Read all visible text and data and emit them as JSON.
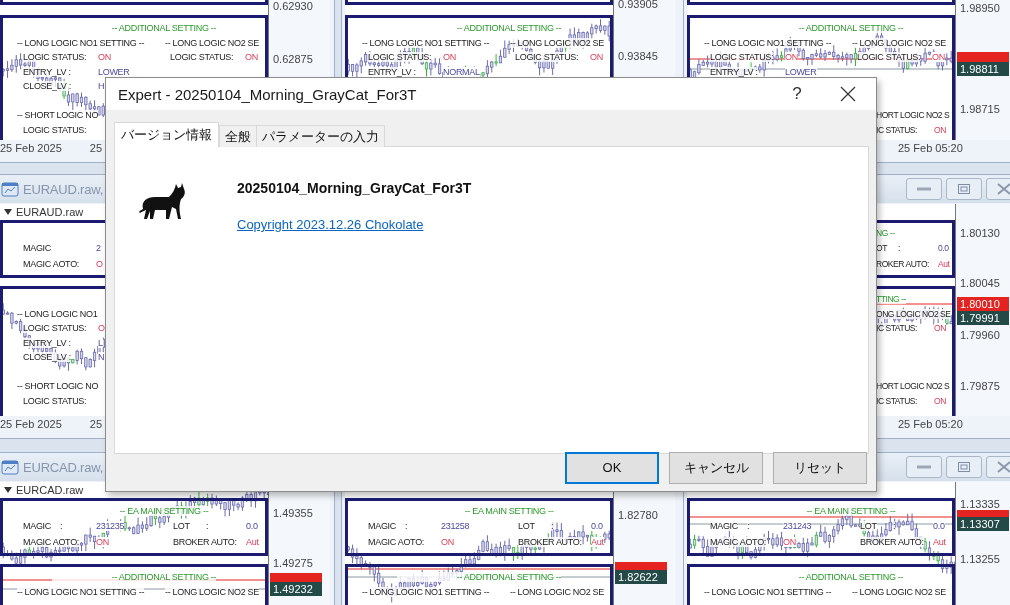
{
  "window_rows": [
    {
      "windows": [
        {
          "panels": [
            {
              "kind": "edge"
            },
            {
              "kind": "logic",
              "rows": [
                {
                  "kind": "heading",
                  "clipped": false,
                  "text": "-- ADDITIONAL SETTING --"
                },
                {
                  "kind": "titles",
                  "clipped": false,
                  "texts": [
                    "-- LONG LOGIC NO1 SETTING --",
                    "-- LONG LOGIC NO2 SE"
                  ]
                },
                {
                  "kind": "fields",
                  "clipped": false,
                  "fields": [
                    {
                      "label": "LOGIC STATUS:",
                      "value": "ON",
                      "alert": true
                    },
                    {
                      "label": "LOGIC STATUS:",
                      "value": "ON",
                      "alert": true
                    }
                  ]
                },
                {
                  "kind": "fields",
                  "clipped": false,
                  "fields": [
                    {
                      "label": "ENTRY_LV :",
                      "value": "LOWER",
                      "alert": false
                    }
                  ]
                },
                {
                  "kind": "fields",
                  "clipped": false,
                  "fields": [
                    {
                      "label": "CLOSE_LV :",
                      "value": "H",
                      "alert": false
                    }
                  ]
                },
                {
                  "kind": "gap"
                },
                {
                  "kind": "titles",
                  "clipped": false,
                  "texts": [
                    "-- SHORT LOGIC NO"
                  ]
                },
                {
                  "kind": "fields",
                  "clipped": false,
                  "fields": [
                    {
                      "label": "LOGIC STATUS:"
                    }
                  ]
                }
              ]
            }
          ],
          "prices": [
            {
              "kind": "tick",
              "text": "0.62930"
            },
            {
              "kind": "tick",
              "text": "0.62875"
            }
          ],
          "dates": [
            "25 Feb 2025",
            "25"
          ]
        },
        {
          "panels": [
            {
              "kind": "edge"
            },
            {
              "kind": "logic",
              "rows": [
                {
                  "kind": "heading",
                  "clipped": false,
                  "text": "-- ADDITIONAL SETTING --"
                },
                {
                  "kind": "titles",
                  "clipped": false,
                  "texts": [
                    "-- LONG LOGIC NO1 SETTING --",
                    "-- LONG LOGIC NO2 SE"
                  ]
                },
                {
                  "kind": "fields",
                  "clipped": false,
                  "fields": [
                    {
                      "label": "LOGIC STATUS:",
                      "value": "ON",
                      "alert": true
                    },
                    {
                      "label": "LOGIC STATUS:",
                      "value": "ON",
                      "alert": true
                    }
                  ]
                },
                {
                  "kind": "fields",
                  "clipped": false,
                  "fields": [
                    {
                      "label": "ENTRY_LV :",
                      "value": "NORMAL",
                      "alert": false
                    }
                  ]
                }
              ]
            }
          ],
          "prices": [
            {
              "kind": "tick",
              "text": "0.93905"
            },
            {
              "kind": "tick",
              "text": "0.93845"
            }
          ]
        },
        {
          "panels": [
            {
              "kind": "edge"
            },
            {
              "kind": "logic",
              "rows": [
                {
                  "kind": "heading",
                  "clipped": false,
                  "text": "-- ADDITIONAL SETTING --"
                },
                {
                  "kind": "titles",
                  "clipped": false,
                  "texts": [
                    "-- LONG LOGIC NO1 SETTING --",
                    "-- LONG LOGIC NO2 SE"
                  ]
                },
                {
                  "kind": "fields",
                  "clipped": false,
                  "fields": [
                    {
                      "label": "LOGIC STATUS:",
                      "value": "ON",
                      "alert": true
                    },
                    {
                      "label": "LOGIC STATUS:",
                      "value": "ON",
                      "alert": true
                    }
                  ]
                },
                {
                  "kind": "fields",
                  "clipped": false,
                  "fields": [
                    {
                      "label": "ENTRY_LV :",
                      "value": "LOWER",
                      "alert": false
                    }
                  ]
                },
                {
                  "kind": "gap"
                },
                {
                  "kind": "gap"
                },
                {
                  "kind": "titles",
                  "clipped": true,
                  "texts": [
                    "HORT LOGIC NO2 S"
                  ]
                },
                {
                  "kind": "fields",
                  "clipped": true,
                  "fields": [
                    {
                      "label": "IC STATUS:",
                      "value": "ON",
                      "alert": true
                    }
                  ]
                }
              ]
            }
          ],
          "prices": [
            {
              "kind": "tick",
              "text": "1.98950"
            },
            {
              "kind": "ask"
            },
            {
              "kind": "bid",
              "text": "1.98811"
            },
            {
              "kind": "tick",
              "text": "1.98715"
            }
          ],
          "dates": [
            "25 Feb 05:20"
          ]
        }
      ]
    },
    {
      "windows": [
        {
          "title": "EURAUD.raw,",
          "controls": false,
          "header": "EURAUD.raw",
          "panels": [
            {
              "kind": "main",
              "rows": [
                {
                  "kind": "gap"
                },
                {
                  "kind": "fields",
                  "clipped": false,
                  "fields": [
                    {
                      "label": "MAGIC",
                      "value": "2",
                      "alert": false
                    }
                  ]
                },
                {
                  "kind": "fields",
                  "clipped": false,
                  "fields": [
                    {
                      "label": "MAGIC AOTO:",
                      "value": "O",
                      "alert": true
                    }
                  ]
                }
              ]
            },
            {
              "kind": "logic",
              "rows": [
                {
                  "kind": "gap"
                },
                {
                  "kind": "titles",
                  "clipped": false,
                  "texts": [
                    "-- LONG LOGIC NO1"
                  ]
                },
                {
                  "kind": "fields",
                  "clipped": false,
                  "fields": [
                    {
                      "label": "LOGIC STATUS:",
                      "value": "O",
                      "alert": true
                    }
                  ]
                },
                {
                  "kind": "fields",
                  "clipped": false,
                  "fields": [
                    {
                      "label": "ENTRY_LV :",
                      "value": "L",
                      "alert": false
                    }
                  ]
                },
                {
                  "kind": "fields",
                  "clipped": false,
                  "fields": [
                    {
                      "label": "CLOSE_LV :",
                      "value": "N",
                      "alert": false
                    }
                  ]
                },
                {
                  "kind": "gap"
                },
                {
                  "kind": "titles",
                  "clipped": false,
                  "texts": [
                    "-- SHORT LOGIC NO"
                  ]
                },
                {
                  "kind": "fields",
                  "clipped": false,
                  "fields": [
                    {
                      "label": "LOGIC STATUS:"
                    }
                  ]
                }
              ]
            }
          ],
          "dates": [
            "25 Feb 2025",
            "25"
          ]
        },
        {
          "controls": true,
          "panels": [
            {
              "kind": "main",
              "rows": [
                {
                  "kind": "heading",
                  "clipped": true,
                  "text": "NG --"
                },
                {
                  "kind": "fields",
                  "clipped": true,
                  "fields": [
                    {
                      "label": "OT",
                      "sep": ":",
                      "value": "0.0",
                      "alert": false
                    }
                  ]
                },
                {
                  "kind": "fields",
                  "clipped": true,
                  "fields": [
                    {
                      "label": "ROKER AUTO:",
                      "value": "Aut",
                      "alert": true
                    }
                  ]
                }
              ]
            },
            {
              "kind": "logic",
              "rows": [
                {
                  "kind": "heading",
                  "clipped": true,
                  "text": "TTING --"
                },
                {
                  "kind": "titles",
                  "clipped": true,
                  "texts": [
                    "ONG LOGIC NO2 SE"
                  ]
                },
                {
                  "kind": "fields",
                  "clipped": true,
                  "fields": [
                    {
                      "label": "IC STATUS:",
                      "value": "ON",
                      "alert": true
                    }
                  ]
                },
                {
                  "kind": "gap"
                },
                {
                  "kind": "gap"
                },
                {
                  "kind": "gap"
                },
                {
                  "kind": "titles",
                  "clipped": true,
                  "texts": [
                    "HORT LOGIC NO2 S"
                  ]
                },
                {
                  "kind": "fields",
                  "clipped": true,
                  "fields": [
                    {
                      "label": "IC STATUS:",
                      "value": "ON",
                      "alert": true
                    }
                  ]
                }
              ]
            }
          ],
          "prices": [
            {
              "kind": "tick",
              "text": "1.80130"
            },
            {
              "kind": "tick",
              "text": "1.80045"
            },
            {
              "kind": "ask",
              "text": "1.80010"
            },
            {
              "kind": "bid",
              "text": "1.79991"
            },
            {
              "kind": "tick",
              "text": "1.79960"
            },
            {
              "kind": "tick",
              "text": "1.79875"
            }
          ],
          "dates": [
            "25 Feb 05:20"
          ]
        }
      ]
    },
    {
      "windows": [
        {
          "title": "EURCAD.raw,",
          "controls": false,
          "header": "EURCAD.raw",
          "panels": [
            {
              "kind": "main",
              "rows": [
                {
                  "kind": "heading",
                  "clipped": false,
                  "text": "-- EA MAIN SETTING --"
                },
                {
                  "kind": "fields",
                  "clipped": false,
                  "fields": [
                    {
                      "label": "MAGIC",
                      "sep": ":",
                      "value": "231235",
                      "alert": false
                    },
                    {
                      "label": "LOT",
                      "sep": ":",
                      "value": "0.0",
                      "alert": false
                    }
                  ]
                },
                {
                  "kind": "fields",
                  "clipped": false,
                  "fields": [
                    {
                      "label": "MAGIC AOTO:",
                      "value": "ON",
                      "alert": true
                    },
                    {
                      "label": "BROKER AUTO:",
                      "value": "Aut",
                      "alert": true
                    }
                  ]
                }
              ]
            },
            {
              "kind": "logic",
              "rows": [
                {
                  "kind": "heading",
                  "clipped": false,
                  "text": "-- ADDITIONAL SETTING --"
                },
                {
                  "kind": "titles",
                  "clipped": false,
                  "texts": [
                    "-- LONG LOGIC NO1 SETTING --",
                    "-- LONG LOGIC NO2 SE"
                  ]
                }
              ]
            }
          ],
          "prices": [
            {
              "kind": "tick",
              "text": "1.49355"
            },
            {
              "kind": "tick",
              "text": "1.49275"
            },
            {
              "kind": "ask"
            },
            {
              "kind": "bid",
              "text": "1.49232"
            }
          ]
        },
        {
          "controls": false,
          "panels": [
            {
              "kind": "main",
              "rows": [
                {
                  "kind": "heading",
                  "clipped": false,
                  "text": "-- EA MAIN SETTING --"
                },
                {
                  "kind": "fields",
                  "clipped": false,
                  "fields": [
                    {
                      "label": "MAGIC",
                      "sep": ":",
                      "value": "231258",
                      "alert": false
                    },
                    {
                      "label": "LOT",
                      "sep": ":",
                      "value": "0.0",
                      "alert": false
                    }
                  ]
                },
                {
                  "kind": "fields",
                  "clipped": false,
                  "fields": [
                    {
                      "label": "MAGIC AOTO:",
                      "value": "ON",
                      "alert": true
                    },
                    {
                      "label": "BROKER AUTO:",
                      "value": "Aut",
                      "alert": true
                    }
                  ]
                }
              ]
            },
            {
              "kind": "logic",
              "rows": [
                {
                  "kind": "heading",
                  "clipped": false,
                  "text": "-- ADDITIONAL SETTING --"
                },
                {
                  "kind": "titles",
                  "clipped": false,
                  "texts": [
                    "-- LONG LOGIC NO1 SETTING --",
                    "-- LONG LOGIC NO2 SE"
                  ]
                }
              ]
            }
          ],
          "prices": [
            {
              "kind": "tick",
              "text": "1.82780"
            },
            {
              "kind": "ask"
            },
            {
              "kind": "bid",
              "text": "1.82622"
            }
          ]
        },
        {
          "controls": true,
          "panels": [
            {
              "kind": "main",
              "rows": [
                {
                  "kind": "heading",
                  "clipped": false,
                  "text": "-- EA MAIN SETTING --"
                },
                {
                  "kind": "fields",
                  "clipped": false,
                  "fields": [
                    {
                      "label": "MAGIC",
                      "sep": ":",
                      "value": "231243",
                      "alert": false
                    },
                    {
                      "label": "LOT",
                      "sep": ":",
                      "value": "0.0",
                      "alert": false
                    }
                  ]
                },
                {
                  "kind": "fields",
                  "clipped": false,
                  "fields": [
                    {
                      "label": "MAGIC AOTO:",
                      "value": "ON",
                      "alert": true
                    },
                    {
                      "label": "BROKER AUTO:",
                      "value": "Aut",
                      "alert": true
                    }
                  ]
                }
              ]
            },
            {
              "kind": "logic",
              "rows": [
                {
                  "kind": "heading",
                  "clipped": false,
                  "text": "-- ADDITIONAL SETTING --"
                },
                {
                  "kind": "titles",
                  "clipped": false,
                  "texts": [
                    "-- LONG LOGIC NO1 SETTING --",
                    "-- LONG LOGIC NO2 SE"
                  ]
                }
              ]
            }
          ],
          "prices": [
            {
              "kind": "tick",
              "text": "1.13335"
            },
            {
              "kind": "ask"
            },
            {
              "kind": "bid",
              "text": "1.13307"
            },
            {
              "kind": "tick",
              "text": "1.13255"
            }
          ]
        }
      ]
    }
  ],
  "dialog": {
    "title": "Expert - 20250104_Morning_GrayCat_For3T",
    "help": "?",
    "tabs": [
      {
        "label": "バージョン情報",
        "selected": true
      },
      {
        "label": "全般",
        "selected": false
      },
      {
        "label": "パラメーターの入力",
        "selected": false
      }
    ],
    "name": "20250104_Morning_GrayCat_For3T",
    "link": "Copyright 2023.12.26 Chokolate",
    "buttons": [
      {
        "label": "OK",
        "focused": true
      },
      {
        "label": "キャンセル",
        "focused": false
      },
      {
        "label": "リセット",
        "focused": false
      }
    ]
  }
}
